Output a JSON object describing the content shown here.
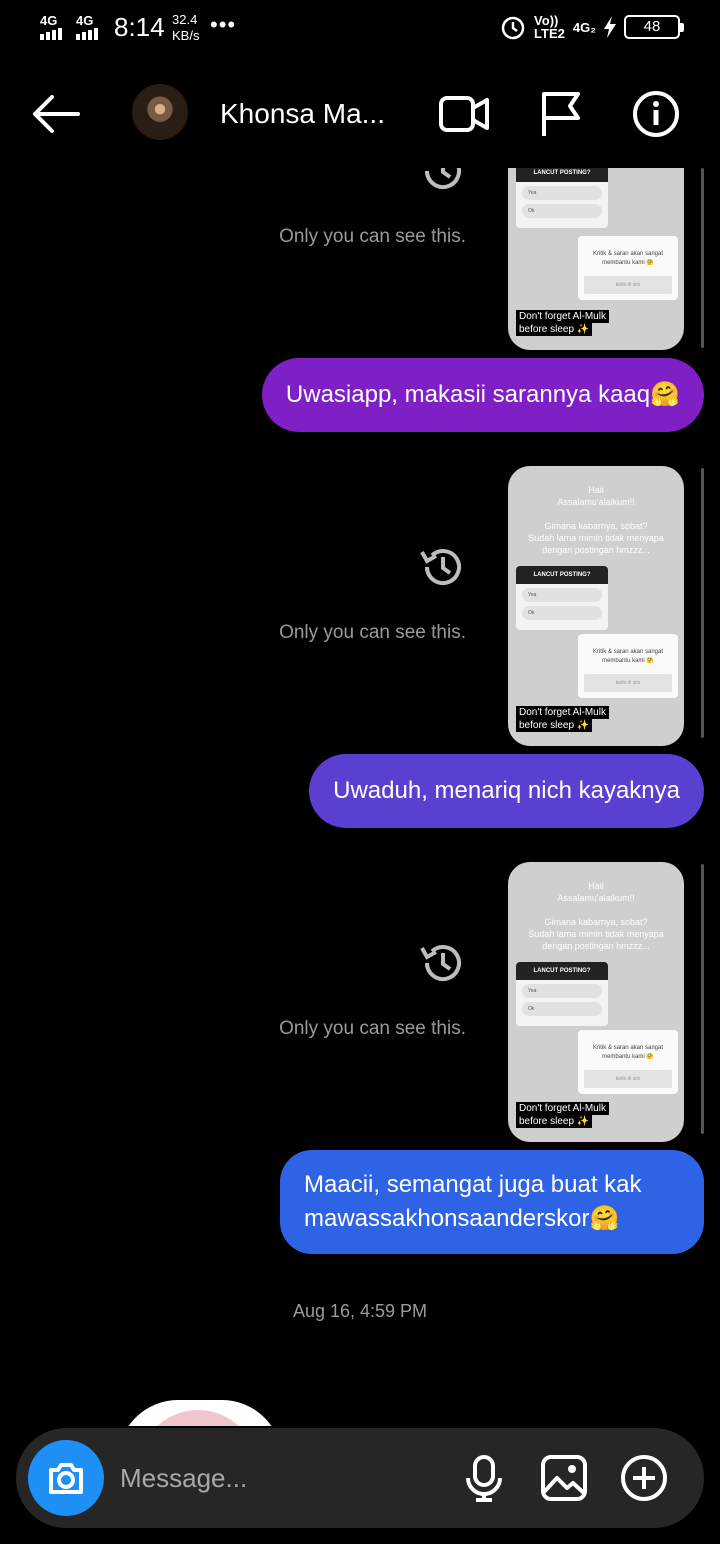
{
  "status_bar": {
    "net1": "4G",
    "net2": "4G",
    "time": "8:14",
    "speed_value": "32.4",
    "speed_unit": "KB/s",
    "dots": "•••",
    "volte": "Vo))",
    "lte": "LTE2",
    "net3": "4G₂",
    "battery": "48"
  },
  "header": {
    "contact_name": "Khonsa Ma..."
  },
  "story_template": {
    "line1": "Haii",
    "line2": "Assalamu'alaikum!!",
    "line3": "Gimana kabarnya, sobat?",
    "line4": "Sudah lama mimin tidak menyapa",
    "line5": "dengan postingan hmzzz...",
    "poll_title": "LANCUT POSTING?",
    "poll_opt1": "Yea",
    "poll_opt2": "Ok",
    "question": "Kritik & saran akan sangat",
    "question2": "membantu kami 🤗",
    "answer_placeholder": "ketik di sini",
    "sticker_line1": "Don't forget Al-Mulk",
    "sticker_line2": "before sleep ✨"
  },
  "messages": [
    {
      "only_you": "Only you can see this."
    },
    {
      "text": "Uwasiapp, makasii sarannya kaaq🤗"
    },
    {
      "only_you": "Only you can see this."
    },
    {
      "text": "Uwaduh, menariq nich kayaknya"
    },
    {
      "only_you": "Only you can see this."
    },
    {
      "text": "Maacii, semangat juga buat kak mawassakhonsaanderskor🤗"
    }
  ],
  "timestamp": "Aug 16, 4:59 PM",
  "composer": {
    "placeholder": "Message..."
  }
}
